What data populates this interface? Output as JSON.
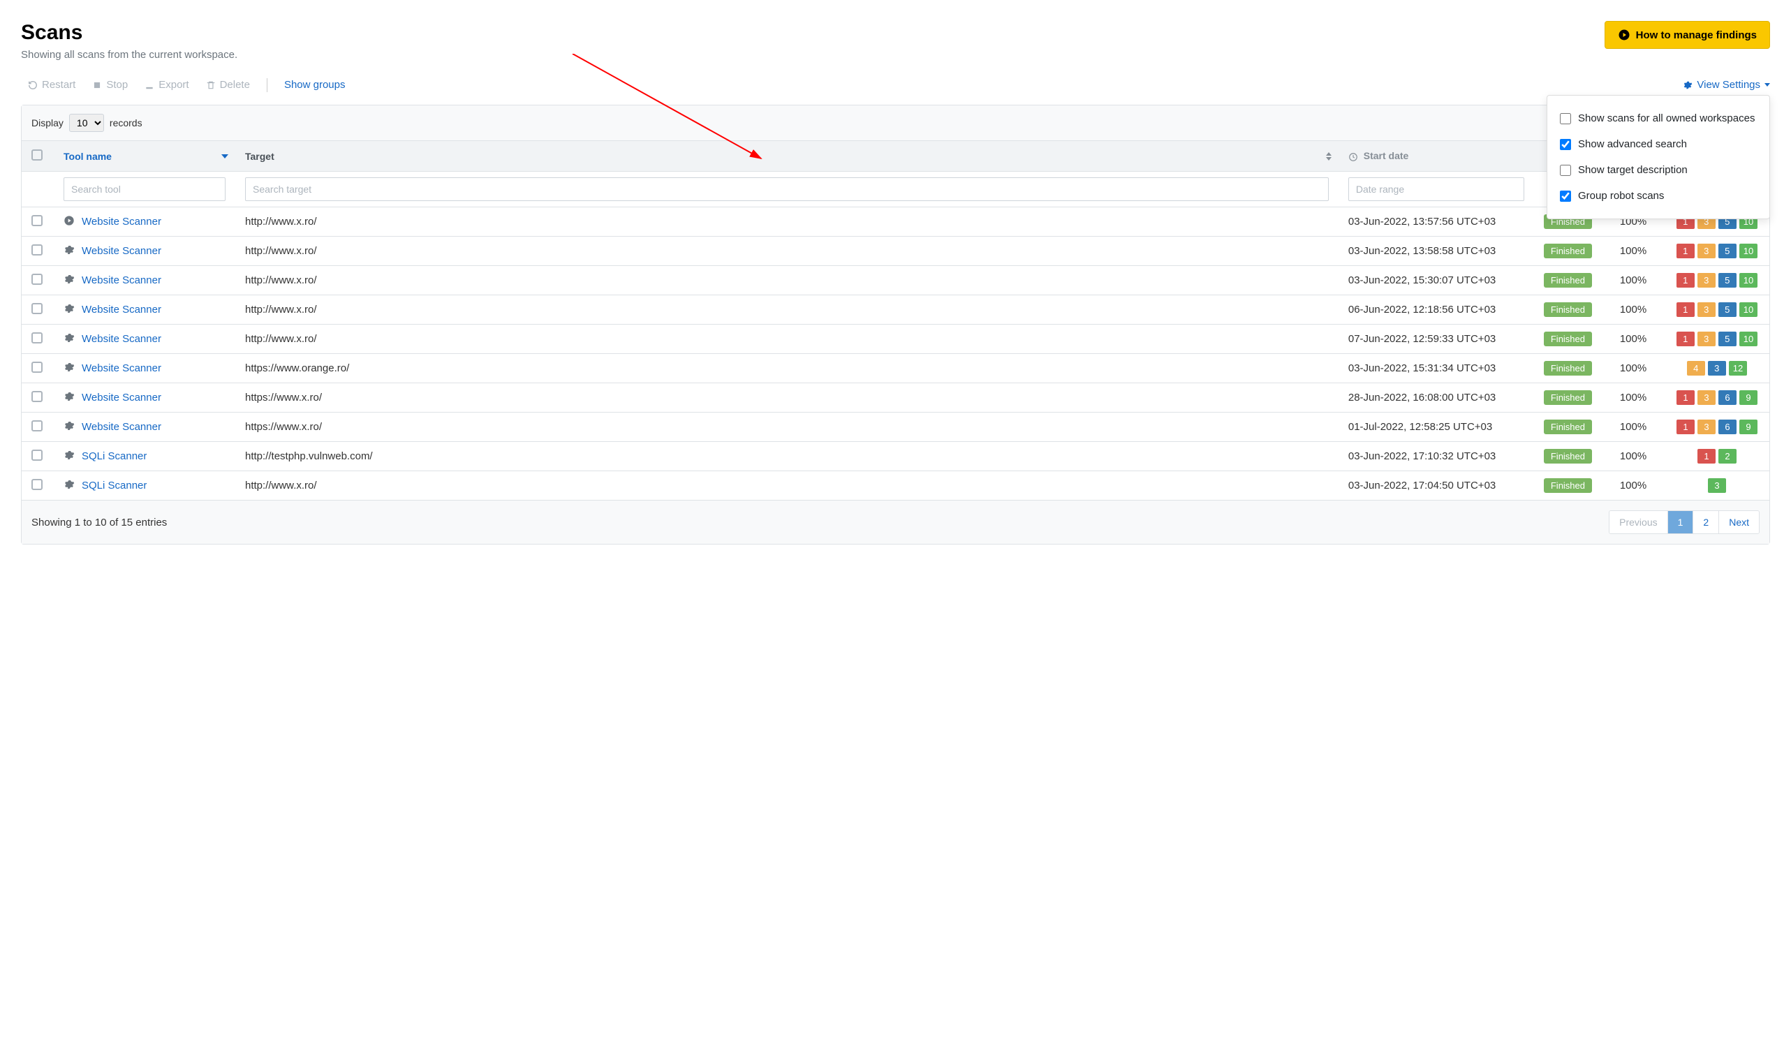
{
  "header": {
    "title": "Scans",
    "subtitle": "Showing all scans from the current workspace.",
    "manage_button": "How to manage findings"
  },
  "toolbar": {
    "restart": "Restart",
    "stop": "Stop",
    "export": "Export",
    "delete": "Delete",
    "show_groups": "Show groups",
    "view_settings": "View Settings"
  },
  "view_settings_menu": {
    "opt0": {
      "label": "Show scans for all owned workspaces",
      "checked": false
    },
    "opt1": {
      "label": "Show advanced search",
      "checked": true
    },
    "opt2": {
      "label": "Show target description",
      "checked": false
    },
    "opt3": {
      "label": "Group robot scans",
      "checked": true
    }
  },
  "display_bar": {
    "prefix": "Display",
    "value": "10",
    "suffix": "records"
  },
  "columns": {
    "tool": "Tool name",
    "target": "Target",
    "start": "Start date"
  },
  "filters": {
    "tool_ph": "Search tool",
    "target_ph": "Search target",
    "date_ph": "Date range"
  },
  "rows": [
    {
      "icon": "play",
      "tool": "Website Scanner",
      "target": "http://www.x.ro/",
      "date": "03-Jun-2022, 13:57:56 UTC+03",
      "status": "Finished",
      "progress": "100%",
      "sev": [
        [
          "red",
          "1"
        ],
        [
          "orange",
          "3"
        ],
        [
          "blue",
          "5"
        ],
        [
          "green",
          "10"
        ]
      ]
    },
    {
      "icon": "gear",
      "tool": "Website Scanner",
      "target": "http://www.x.ro/",
      "date": "03-Jun-2022, 13:58:58 UTC+03",
      "status": "Finished",
      "progress": "100%",
      "sev": [
        [
          "red",
          "1"
        ],
        [
          "orange",
          "3"
        ],
        [
          "blue",
          "5"
        ],
        [
          "green",
          "10"
        ]
      ]
    },
    {
      "icon": "gear",
      "tool": "Website Scanner",
      "target": "http://www.x.ro/",
      "date": "03-Jun-2022, 15:30:07 UTC+03",
      "status": "Finished",
      "progress": "100%",
      "sev": [
        [
          "red",
          "1"
        ],
        [
          "orange",
          "3"
        ],
        [
          "blue",
          "5"
        ],
        [
          "green",
          "10"
        ]
      ]
    },
    {
      "icon": "gear",
      "tool": "Website Scanner",
      "target": "http://www.x.ro/",
      "date": "06-Jun-2022, 12:18:56 UTC+03",
      "status": "Finished",
      "progress": "100%",
      "sev": [
        [
          "red",
          "1"
        ],
        [
          "orange",
          "3"
        ],
        [
          "blue",
          "5"
        ],
        [
          "green",
          "10"
        ]
      ]
    },
    {
      "icon": "gear",
      "tool": "Website Scanner",
      "target": "http://www.x.ro/",
      "date": "07-Jun-2022, 12:59:33 UTC+03",
      "status": "Finished",
      "progress": "100%",
      "sev": [
        [
          "red",
          "1"
        ],
        [
          "orange",
          "3"
        ],
        [
          "blue",
          "5"
        ],
        [
          "green",
          "10"
        ]
      ]
    },
    {
      "icon": "gear",
      "tool": "Website Scanner",
      "target": "https://www.orange.ro/",
      "date": "03-Jun-2022, 15:31:34 UTC+03",
      "status": "Finished",
      "progress": "100%",
      "sev": [
        [
          "orange",
          "4"
        ],
        [
          "blue",
          "3"
        ],
        [
          "green",
          "12"
        ]
      ]
    },
    {
      "icon": "gear",
      "tool": "Website Scanner",
      "target": "https://www.x.ro/",
      "date": "28-Jun-2022, 16:08:00 UTC+03",
      "status": "Finished",
      "progress": "100%",
      "sev": [
        [
          "red",
          "1"
        ],
        [
          "orange",
          "3"
        ],
        [
          "blue",
          "6"
        ],
        [
          "green",
          "9"
        ]
      ]
    },
    {
      "icon": "gear",
      "tool": "Website Scanner",
      "target": "https://www.x.ro/",
      "date": "01-Jul-2022, 12:58:25 UTC+03",
      "status": "Finished",
      "progress": "100%",
      "sev": [
        [
          "red",
          "1"
        ],
        [
          "orange",
          "3"
        ],
        [
          "blue",
          "6"
        ],
        [
          "green",
          "9"
        ]
      ]
    },
    {
      "icon": "gear",
      "tool": "SQLi Scanner",
      "target": "http://testphp.vulnweb.com/",
      "date": "03-Jun-2022, 17:10:32 UTC+03",
      "status": "Finished",
      "progress": "100%",
      "sev": [
        [
          "red",
          "1"
        ],
        [
          "green",
          "2"
        ]
      ]
    },
    {
      "icon": "gear",
      "tool": "SQLi Scanner",
      "target": "http://www.x.ro/",
      "date": "03-Jun-2022, 17:04:50 UTC+03",
      "status": "Finished",
      "progress": "100%",
      "sev": [
        [
          "green",
          "3"
        ]
      ]
    }
  ],
  "footer": {
    "info": "Showing 1 to 10 of 15 entries",
    "prev": "Previous",
    "pages": [
      "1",
      "2"
    ],
    "next": "Next",
    "active_page": "1"
  }
}
